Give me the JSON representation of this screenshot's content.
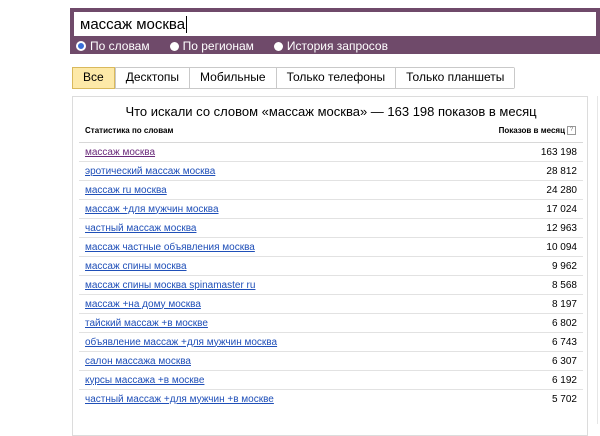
{
  "search": {
    "query": "массаж москва",
    "modes": [
      {
        "label": "По словам",
        "checked": true
      },
      {
        "label": "По регионам",
        "checked": false
      },
      {
        "label": "История запросов",
        "checked": false
      }
    ]
  },
  "tabs": [
    {
      "label": "Все",
      "active": true
    },
    {
      "label": "Десктопы",
      "active": false
    },
    {
      "label": "Мобильные",
      "active": false
    },
    {
      "label": "Только телефоны",
      "active": false
    },
    {
      "label": "Только планшеты",
      "active": false
    }
  ],
  "panel": {
    "title": "Что искали со словом «массаж москва» — 163 198 показов в месяц",
    "col_left": "Статистика по словам",
    "col_right": "Показов в месяц",
    "help_icon": "?"
  },
  "rows": [
    {
      "phrase": "массаж москва",
      "count": "163 198"
    },
    {
      "phrase": "эротический массаж москва",
      "count": "28 812"
    },
    {
      "phrase": "массаж ru москва",
      "count": "24 280"
    },
    {
      "phrase": "массаж +для мужчин москва",
      "count": "17 024"
    },
    {
      "phrase": "частный массаж москва",
      "count": "12 963"
    },
    {
      "phrase": "массаж частные объявления москва",
      "count": "10 094"
    },
    {
      "phrase": "массаж спины москва",
      "count": "9 962"
    },
    {
      "phrase": "массаж спины москва spinamaster ru",
      "count": "8 568"
    },
    {
      "phrase": "массаж +на дому москва",
      "count": "8 197"
    },
    {
      "phrase": "тайский массаж +в москве",
      "count": "6 802"
    },
    {
      "phrase": "объявление массаж +для мужчин москва",
      "count": "6 743"
    },
    {
      "phrase": "салон массажа москва",
      "count": "6 307"
    },
    {
      "phrase": "курсы массажа +в москве",
      "count": "6 192"
    },
    {
      "phrase": "частный массаж +для мужчин +в москве",
      "count": "5 702"
    }
  ]
}
